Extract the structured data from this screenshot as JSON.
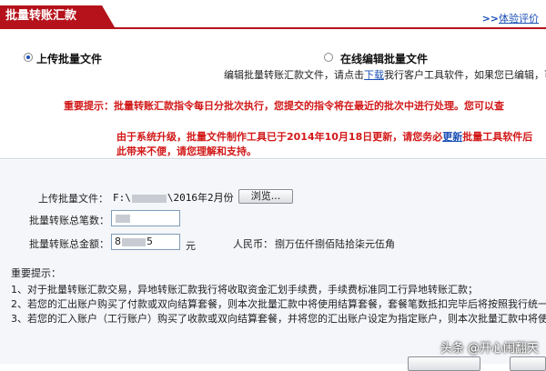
{
  "header": {
    "tab_title": "批量转账汇款",
    "eval_link_prefix": ">>",
    "eval_link": "体验评价"
  },
  "options": {
    "upload": "上传批量文件",
    "online": "在线编辑批量文件",
    "selected": "upload"
  },
  "description": {
    "before_link": "编辑批量转账汇款文件，请点击",
    "link": "下载",
    "after_link": "我行客户工具软件，如果您已编辑，可"
  },
  "important_notice": {
    "label": "重要提示：",
    "text": "批量转账汇款指令每日分批次执行，您提交的指令将在最近的批次中进行处理。您可以查"
  },
  "upgrade_notice": {
    "line1_before": "由于系统升级，批量文件制作工具已于2014年10月18日更新，请您务必",
    "line1_link": "更新",
    "line1_after": "批量工具软件后",
    "line2": "此带来不便，请您理解和支持。"
  },
  "form": {
    "file_label": "上传批量文件：",
    "file_prefix": "F:\\",
    "file_suffix": "\\2016年2月份",
    "browse": "浏览...",
    "count_label": "批量转账总笔数：",
    "amount_label": "批量转账总金额：",
    "amount_start": "8",
    "amount_end": "5",
    "unit": "元",
    "rmb_label": "人民币：",
    "rmb_words": "捌万伍仟捌佰陆拾柒元伍角"
  },
  "notes": {
    "title": "重要提示：",
    "items": [
      "1、对于批量转账汇款交易，异地转账汇款我行将收取资金汇划手续费，手续费标准同工行异地转账汇款；",
      "2、若您的汇出账户购买了付款或双向结算套餐，则本次批量汇款中将使用结算套餐，套餐笔数抵扣完毕后将按照我行统一",
      "3、若您的汇入账户（工行账户）购买了收款或双向结算套餐，并将您的汇出账户设定为指定账户，则本次批量汇款中将使"
    ]
  },
  "watermark": "头条 @开心闹翻天"
}
